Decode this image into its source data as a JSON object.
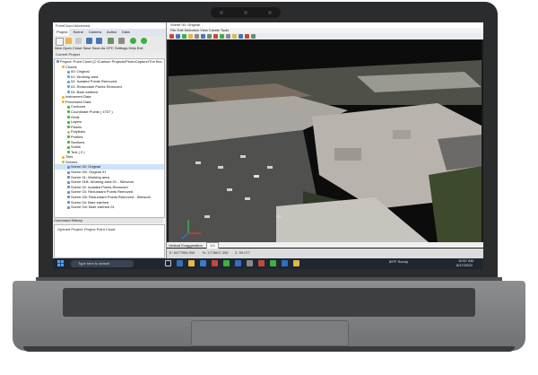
{
  "left_window": {
    "title": "PointCloud Advanced",
    "tabs": [
      "Project",
      "Scene",
      "Camera",
      "Action",
      "Data"
    ],
    "toolbar_labels": "New Open Close Save Save As CPC Settings Help Exit",
    "current_project_label": "Current Project",
    "tree": [
      {
        "label": "Project: Point Cloud [C:\\Carlson Projects\\PhotoCapture\\The Bro...",
        "indent": 0,
        "color": "#6a8fbf"
      },
      {
        "label": "Clouds",
        "indent": 1,
        "color": "#e0b84a"
      },
      {
        "label": "00: Original",
        "indent": 2,
        "color": "#5aa6d6"
      },
      {
        "label": "01: Working area",
        "indent": 2,
        "color": "#5aa6d6"
      },
      {
        "label": "02: Isolated Points Removed",
        "indent": 2,
        "color": "#5aa6d6"
      },
      {
        "label": "03: Redundant Points Removed",
        "indent": 2,
        "color": "#5aa6d6"
      },
      {
        "label": "04: Bare earthed",
        "indent": 2,
        "color": "#5aa6d6"
      },
      {
        "label": "Instrument Data",
        "indent": 1,
        "color": "#e0b84a"
      },
      {
        "label": "Processed Data",
        "indent": 1,
        "color": "#e0b84a"
      },
      {
        "label": "Contours",
        "indent": 2,
        "color": "#4caf50"
      },
      {
        "label": "Coordinate Points ( 4707 )",
        "indent": 2,
        "color": "#4caf50"
      },
      {
        "label": "Grids",
        "indent": 2,
        "color": "#4caf50"
      },
      {
        "label": "Layers",
        "indent": 2,
        "color": "#4caf50"
      },
      {
        "label": "Planes",
        "indent": 2,
        "color": "#4caf50"
      },
      {
        "label": "Polylines",
        "indent": 2,
        "color": "#e0b84a"
      },
      {
        "label": "Profiles",
        "indent": 2,
        "color": "#4caf50"
      },
      {
        "label": "Sections",
        "indent": 2,
        "color": "#4caf50"
      },
      {
        "label": "Solids",
        "indent": 2,
        "color": "#4caf50"
      },
      {
        "label": "Text ( 0 )",
        "indent": 2,
        "color": "#4caf50"
      },
      {
        "label": "Tiles",
        "indent": 1,
        "color": "#e0b84a"
      },
      {
        "label": "Scenes",
        "indent": 1,
        "color": "#e0b84a"
      },
      {
        "label": "Scene 00: Original",
        "indent": 2,
        "color": "#6a8fbf",
        "selected": true
      },
      {
        "label": "Scene 00i: Original 01",
        "indent": 2,
        "color": "#6a8fbf"
      },
      {
        "label": "Scene 01: Working area",
        "indent": 2,
        "color": "#6a8fbf"
      },
      {
        "label": "Scene 01B: Working area 01 - Sitework",
        "indent": 2,
        "color": "#6a8fbf"
      },
      {
        "label": "Scene 02: Isolated Points Removed",
        "indent": 2,
        "color": "#6a8fbf"
      },
      {
        "label": "Scene 03: Redundant Points Removed",
        "indent": 2,
        "color": "#6a8fbf"
      },
      {
        "label": "Scene 03i: Redundant Points Removed - Sitework",
        "indent": 2,
        "color": "#6a8fbf"
      },
      {
        "label": "Scene 04: Bare earthed",
        "indent": 2,
        "color": "#6a8fbf"
      },
      {
        "label": "Scene 04i: Bare earthed 01",
        "indent": 2,
        "color": "#6a8fbf"
      }
    ],
    "history_label": "Command History",
    "history_text": "Opened Project: Project Point Cloud"
  },
  "right_window": {
    "title": "Scene 00: Original",
    "menu": "File  Edit  Selection  View  Create  Tools",
    "vertical_exaggeration_label": "Vertical Exaggeration",
    "vertical_exaggeration_value": "1.0",
    "status": {
      "easting": "E: 6477954.996",
      "northing": "N: 1778607.398",
      "elevation": "Z: 59.077"
    }
  },
  "taskbar": {
    "search_placeholder": "Type here to search",
    "weather": "89°F  Sunny",
    "time": "10:57 AM",
    "date": "8/17/2022"
  },
  "colors": {
    "accent": "#2f6fc1",
    "toolbar_green": "#3cb043",
    "taskbar": "#1f2630"
  }
}
